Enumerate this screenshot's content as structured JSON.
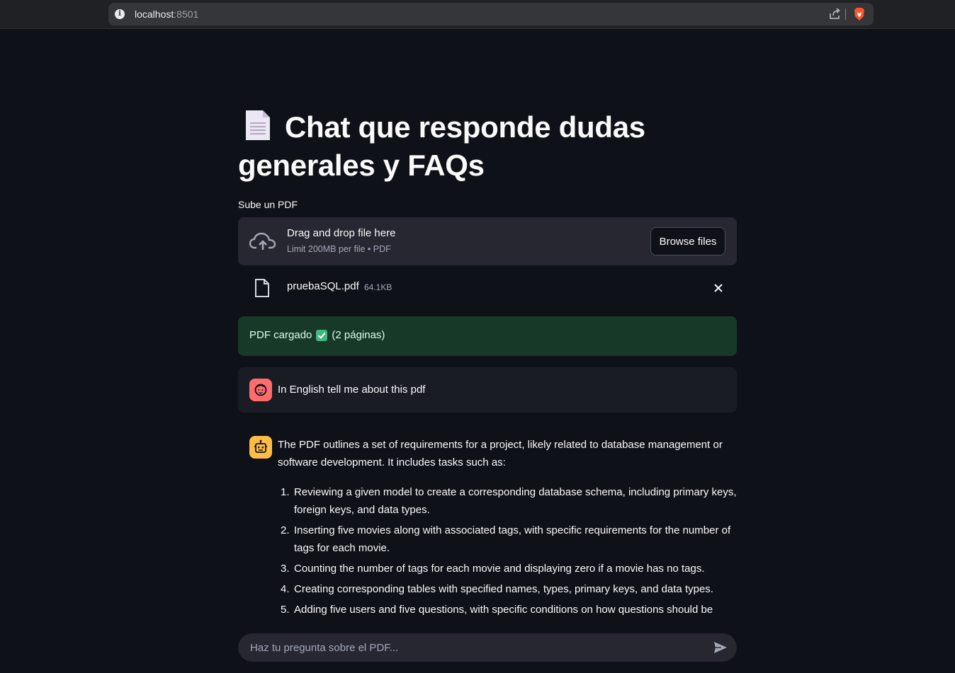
{
  "browser": {
    "url_host": "localhost",
    "url_port": ":8501",
    "icons": [
      "info-icon",
      "share-icon",
      "brave-icon"
    ]
  },
  "page": {
    "title": "Chat que responde dudas generales y FAQs",
    "title_icon": "document-icon"
  },
  "uploader": {
    "label": "Sube un PDF",
    "drop_text": "Drag and drop file here",
    "limit_text": "Limit 200MB per file • PDF",
    "browse_label": "Browse files",
    "icon": "cloud-upload-icon"
  },
  "uploaded_file": {
    "name": "pruebaSQL.pdf",
    "size": "64.1KB",
    "icon": "file-icon",
    "remove_icon": "close-icon"
  },
  "status": {
    "text_before": "PDF cargado",
    "text_after": "(2 páginas)",
    "icon": "check-mark-icon",
    "color": "#173928"
  },
  "chat": {
    "user_message": "In English tell me about this pdf",
    "user_avatar_color": "#ff6c6c",
    "assistant_avatar_color": "#ffbd45",
    "assistant_intro": "The PDF outlines a set of requirements for a project, likely related to database management or software development. It includes tasks such as:",
    "assistant_items": [
      {
        "num": "1.",
        "text": "Reviewing a given model to create a corresponding database schema, including primary keys, foreign keys, and data types."
      },
      {
        "num": "2.",
        "text": "Inserting five movies along with associated tags, with specific requirements for the number of tags for each movie."
      },
      {
        "num": "3.",
        "text": "Counting the number of tags for each movie and displaying zero if a movie has no tags."
      },
      {
        "num": "4.",
        "text": "Creating corresponding tables with specified names, types, primary keys, and data types."
      },
      {
        "num": "5.",
        "text": "Adding five users and five questions, with specific conditions on how questions should be"
      }
    ]
  },
  "chat_input": {
    "placeholder": "Haz tu pregunta sobre el PDF...",
    "value": "",
    "send_icon": "send-icon"
  }
}
